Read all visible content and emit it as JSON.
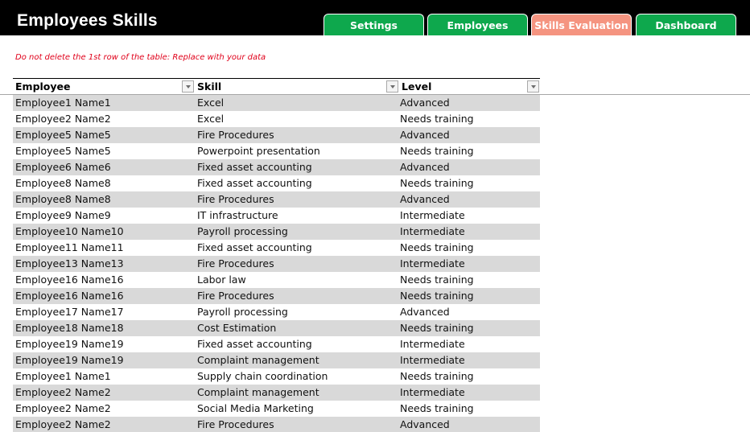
{
  "header": {
    "title": "Employees Skills",
    "background": "#000000"
  },
  "tabs": [
    {
      "label": "Settings",
      "active": false,
      "color": "#0ea84d"
    },
    {
      "label": "Employees",
      "active": false,
      "color": "#0ea84d"
    },
    {
      "label": "Skills Evaluation",
      "active": true,
      "color": "#f59480"
    },
    {
      "label": "Dashboard",
      "active": false,
      "color": "#0ea84d"
    }
  ],
  "note": "Do not delete the 1st row of the table: Replace with your data",
  "table": {
    "columns": [
      "Employee",
      "Skill",
      "Level"
    ],
    "filter_icon": "dropdown-arrow-icon",
    "rows": [
      {
        "employee": "Employee1 Name1",
        "skill": "Excel",
        "level": "Advanced"
      },
      {
        "employee": "Employee2 Name2",
        "skill": "Excel",
        "level": "Needs training"
      },
      {
        "employee": "Employee5 Name5",
        "skill": "Fire Procedures",
        "level": "Advanced"
      },
      {
        "employee": "Employee5 Name5",
        "skill": "Powerpoint presentation",
        "level": "Needs training"
      },
      {
        "employee": "Employee6 Name6",
        "skill": "Fixed asset accounting",
        "level": "Advanced"
      },
      {
        "employee": "Employee8 Name8",
        "skill": "Fixed asset accounting",
        "level": "Needs training"
      },
      {
        "employee": "Employee8 Name8",
        "skill": "Fire Procedures",
        "level": "Advanced"
      },
      {
        "employee": "Employee9 Name9",
        "skill": "IT infrastructure",
        "level": "Intermediate"
      },
      {
        "employee": "Employee10 Name10",
        "skill": "Payroll processing",
        "level": "Intermediate"
      },
      {
        "employee": "Employee11 Name11",
        "skill": "Fixed asset accounting",
        "level": "Needs training"
      },
      {
        "employee": "Employee13 Name13",
        "skill": "Fire Procedures",
        "level": "Intermediate"
      },
      {
        "employee": "Employee16 Name16",
        "skill": "Labor law",
        "level": "Needs training"
      },
      {
        "employee": "Employee16 Name16",
        "skill": "Fire Procedures",
        "level": "Needs training"
      },
      {
        "employee": "Employee17 Name17",
        "skill": "Payroll processing",
        "level": "Advanced"
      },
      {
        "employee": "Employee18 Name18",
        "skill": "Cost Estimation",
        "level": "Needs training"
      },
      {
        "employee": "Employee19 Name19",
        "skill": "Fixed asset accounting",
        "level": "Intermediate"
      },
      {
        "employee": "Employee19 Name19",
        "skill": "Complaint management",
        "level": "Intermediate"
      },
      {
        "employee": "Employee1 Name1",
        "skill": "Supply chain coordination",
        "level": "Needs training"
      },
      {
        "employee": "Employee2 Name2",
        "skill": "Complaint management",
        "level": "Intermediate"
      },
      {
        "employee": "Employee2 Name2",
        "skill": "Social Media Marketing",
        "level": "Needs training"
      },
      {
        "employee": "Employee2 Name2",
        "skill": "Fire Procedures",
        "level": "Advanced"
      }
    ]
  }
}
